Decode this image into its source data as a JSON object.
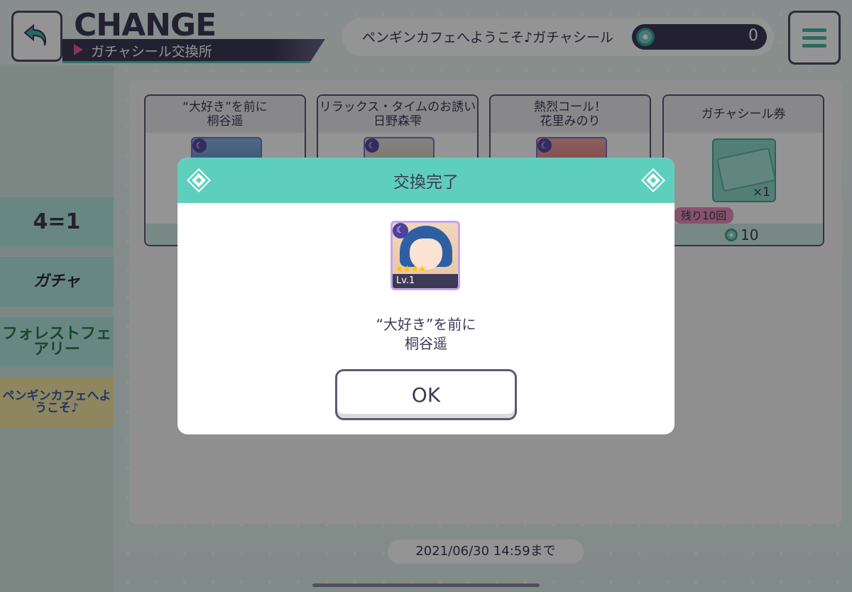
{
  "header": {
    "title": "CHANGE",
    "subtitle": "ガチャシール交換所",
    "event_name": "ペンギンカフェへようこそ♪ガチャシール",
    "sticker_count": "0"
  },
  "sidebar": {
    "items": [
      {
        "label": "4=1"
      },
      {
        "label": "ガチャ"
      },
      {
        "label": "フォレストフェアリー"
      },
      {
        "label": "ペンギンカフェへようこそ♪"
      }
    ]
  },
  "cards": [
    {
      "title_line1": "“大好き”を前に",
      "title_line2": "桐谷遥"
    },
    {
      "title_line1": "リラックス・タイムのお誘い",
      "title_line2": "日野森雫"
    },
    {
      "title_line1": "熱烈コール！",
      "title_line2": "花里みのり"
    },
    {
      "title_line1": "ガチャシール券",
      "quantity": "×1",
      "remaining": "残り10回",
      "price": "10"
    }
  ],
  "deadline": "2021/06/30 14:59まで",
  "modal": {
    "title": "交換完了",
    "card_level": "Lv.1",
    "stars": "★★★★",
    "card_name_line1": "“大好き”を前に",
    "card_name_line2": "桐谷遥",
    "ok_label": "OK"
  }
}
